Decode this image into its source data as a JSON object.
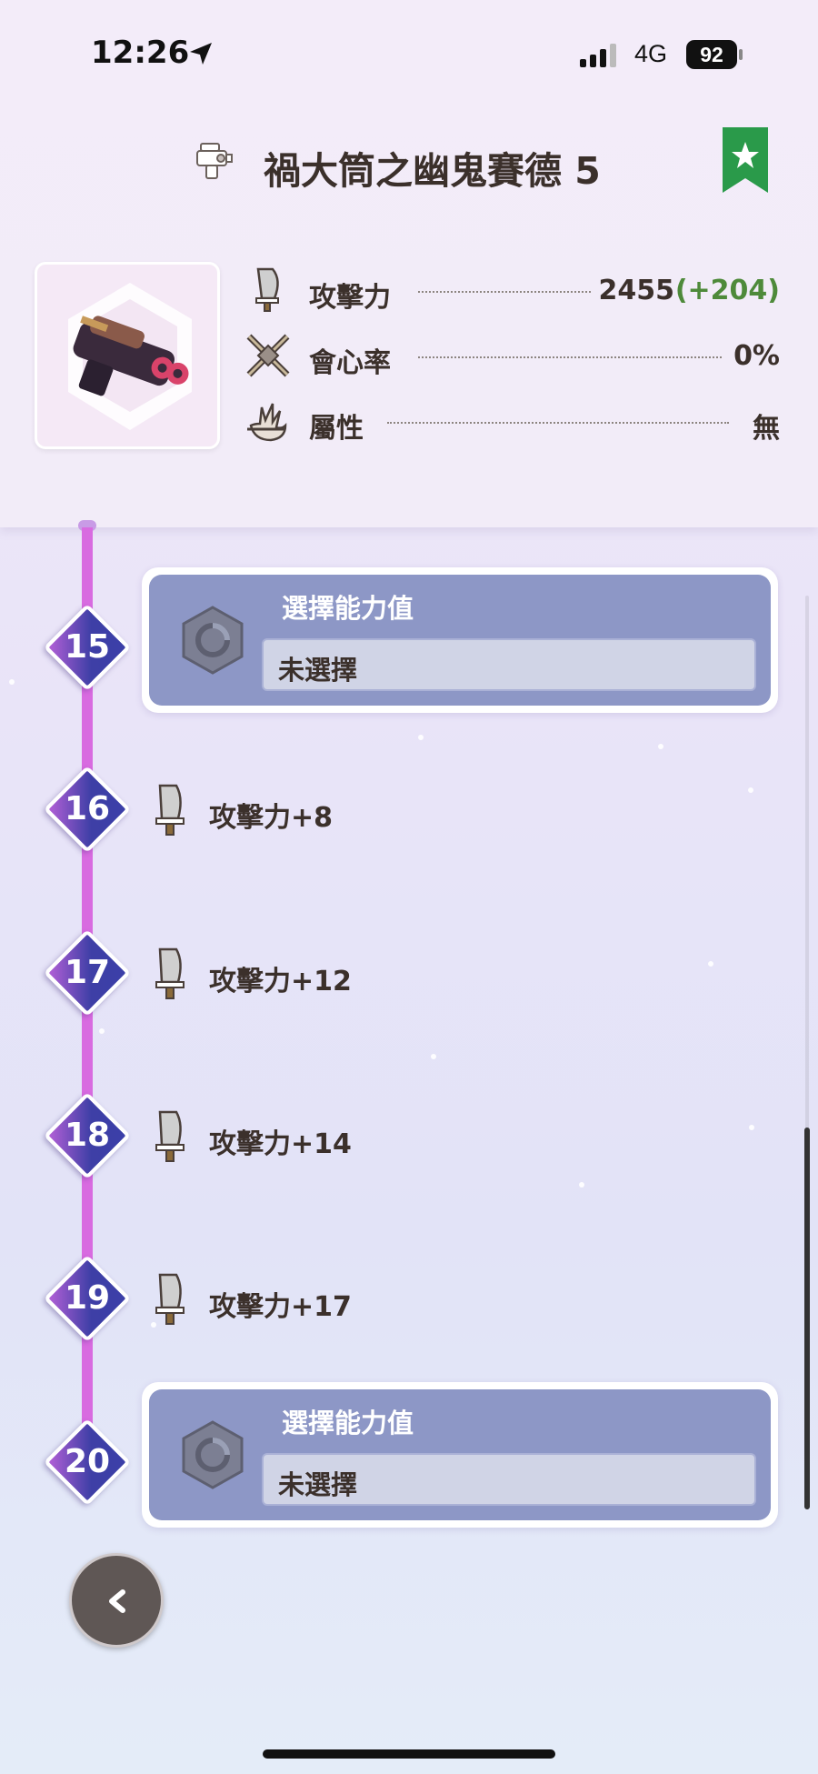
{
  "status_bar": {
    "time": "12:26",
    "network": "4G",
    "battery": "92"
  },
  "header": {
    "title": "禍大筒之幽鬼賽德 5",
    "weapon_type_icon": "heavy-bowgun-icon",
    "bookmark_icon": "star-bookmark-icon",
    "bookmark_color": "#2a9a4a",
    "stats": [
      {
        "icon": "attack-blade-icon",
        "label": "攻擊力",
        "value": "2455",
        "bonus": "(+204)"
      },
      {
        "icon": "affinity-icon",
        "label": "會心率",
        "value": "0%"
      },
      {
        "icon": "element-claw-icon",
        "label": "屬性",
        "value": "無"
      }
    ]
  },
  "timeline": [
    {
      "level": "15",
      "type": "selection",
      "heading": "選擇能力值",
      "value": "未選擇"
    },
    {
      "level": "16",
      "type": "bonus",
      "icon": "attack-blade-icon",
      "text": "攻擊力+8"
    },
    {
      "level": "17",
      "type": "bonus",
      "icon": "attack-blade-icon",
      "text": "攻擊力+12"
    },
    {
      "level": "18",
      "type": "bonus",
      "icon": "attack-blade-icon",
      "text": "攻擊力+14"
    },
    {
      "level": "19",
      "type": "bonus",
      "icon": "attack-blade-icon",
      "text": "攻擊力+17"
    },
    {
      "level": "20",
      "type": "selection",
      "heading": "選擇能力值",
      "value": "未選擇"
    }
  ],
  "colors": {
    "accent_line": "#d86be0",
    "card_bg": "#8d97c6",
    "bonus_green": "#4e8a3a"
  },
  "back_button_icon": "chevron-left-icon"
}
